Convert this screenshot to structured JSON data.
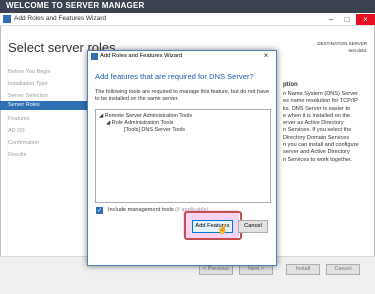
{
  "server_manager": {
    "title": "WELCOME TO SERVER MANAGER"
  },
  "bg_wizard": {
    "title": "Add Roles and Features Wizard",
    "heading": "Select server roles",
    "destination_label": "DESTINATION SERVER",
    "destination_name": "test-ds01",
    "nav": [
      {
        "label": "Before You Begin",
        "active": false
      },
      {
        "label": "Installation Type",
        "active": false
      },
      {
        "label": "Server Selection",
        "active": false
      },
      {
        "label": "Server Roles",
        "active": true
      },
      {
        "label": "Features",
        "active": false
      },
      {
        "label": "AD DS",
        "active": false
      },
      {
        "label": "Confirmation",
        "active": false
      },
      {
        "label": "Results",
        "active": false
      }
    ],
    "section_label": "ption",
    "description_lines": [
      "n Name System (DNS) Server",
      "es name resolution for TCP/IP",
      "ks. DNS Server is easier to",
      "e when it is installed on the",
      "erver as Active Directory",
      "n Services. If you select the",
      "Directory Domain Services",
      "n you can install and configure",
      "server and Active Directory",
      "n Services to work together."
    ],
    "footer": {
      "previous": "< Previous",
      "next": "Next >",
      "install": "Install",
      "cancel": "Cancel"
    }
  },
  "dialog": {
    "title": "Add Roles and Features Wizard",
    "close_glyph": "×",
    "heading": "Add features that are required for DNS Server?",
    "info": "The following tools are required to manage this feature, but do not have to be installed on the same server.",
    "tree": [
      {
        "label": "Remote Server Administration Tools",
        "level": 0
      },
      {
        "label": "Role Administration Tools",
        "level": 1
      },
      {
        "label": "[Tools] DNS Server Tools",
        "level": 2
      }
    ],
    "include_tools": {
      "checked": true,
      "label": "Include management tools ",
      "optional": "(if applicable)"
    },
    "add_features": "Add Features",
    "cancel": "Cancel"
  },
  "colors": {
    "accent": "#2f6fb6",
    "heading_blue": "#1e5ea8",
    "highlight": "#c0504d"
  }
}
